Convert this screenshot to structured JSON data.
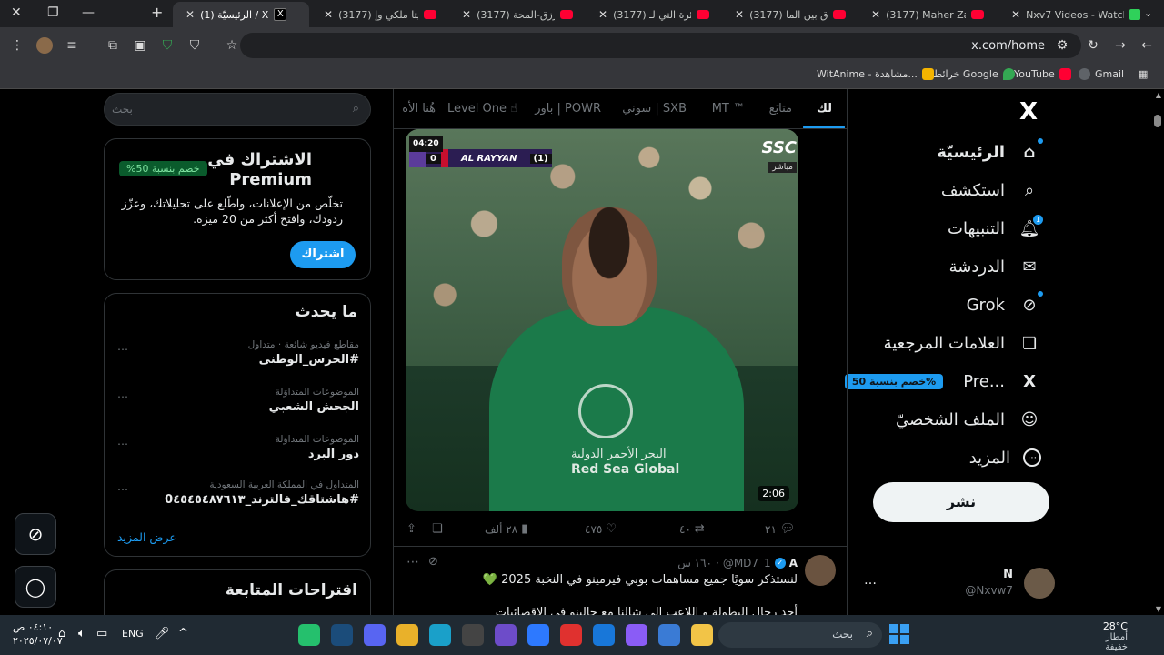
{
  "browser": {
    "tabs": [
      {
        "label": "Nxv7 Videos - Watch",
        "fav": "g"
      },
      {
        "label": "(3177) Maher Zain &",
        "fav": "yt"
      },
      {
        "label": "(3177) الفرق بين الما",
        "fav": "yt"
      },
      {
        "label": "(3177) الطائرة التي لـ",
        "fav": "yt"
      },
      {
        "label": "(3177) رشا رزق-المحة",
        "fav": "yt"
      },
      {
        "label": "(3177) ناديتا ملكي وإ",
        "fav": "yt"
      },
      {
        "label": "(1) الرئيسيّة / X",
        "fav": "x",
        "active": true
      }
    ],
    "new_tab": "+",
    "url": "x.com/home",
    "bookmarks": [
      {
        "label": "Gmail",
        "color": "#ea4335"
      },
      {
        "label": "YouTube",
        "color": "#ff0033"
      },
      {
        "label": "خرائط Google",
        "color": "#34a853"
      },
      {
        "label": "WitAnime - مشاهدة...",
        "color": "#f5b400"
      }
    ]
  },
  "nav": {
    "logo": "X",
    "items": [
      {
        "label": "الرئيسيّة",
        "icon": "home-icon",
        "glyph": "⌂"
      },
      {
        "label": "استكشف",
        "icon": "search-icon",
        "glyph": "⌕"
      },
      {
        "label": "التنبيهات",
        "icon": "bell-icon",
        "glyph": "♫",
        "badge": "1"
      },
      {
        "label": "الدردشة",
        "icon": "mail-icon",
        "glyph": "✉"
      },
      {
        "label": "Grok",
        "icon": "grok-icon",
        "glyph": "⊘"
      },
      {
        "label": "العلامات المرجعية",
        "icon": "bookmark-icon",
        "glyph": "❏"
      },
      {
        "label": "...Pre",
        "icon": "premium-x-icon",
        "glyph": "X",
        "pill": "%خصم بنسبة 50"
      },
      {
        "label": "الملف الشخصيّ",
        "icon": "profile-icon",
        "glyph": "☺"
      },
      {
        "label": "المزيد",
        "icon": "more-icon",
        "glyph": "⋯"
      }
    ],
    "post_button": "نشر",
    "account": {
      "name": "N",
      "handle": "@Nxvw7",
      "more": "…"
    }
  },
  "timeline": {
    "tabs": [
      "لك",
      "متابَع",
      "MT ™",
      "سوني | SXB",
      "باور | POWR",
      "Level One ☝",
      "هُنا الأه"
    ],
    "video": {
      "clock": "04:20",
      "score_left": "0",
      "team": "AL RAYYAN",
      "score_right": "(1)",
      "broadcaster": "SSC",
      "live": "مباشر",
      "shirt_line1": "البحر الأحمر الدولية",
      "shirt_line2": "Red Sea Global",
      "duration": "2:06"
    },
    "actions": {
      "replies": "٢١",
      "reposts": "٤٠",
      "likes": "٤٧٥",
      "views": "٢٨ ألف"
    },
    "tweet2": {
      "name": "A",
      "handle": "@MD7_1",
      "time": "١٦٠ س",
      "line1": "لنستذكر سويًا جميع مساهمات بوبي فيرمينو في النخبة 2025 💚",
      "line2": "أحد رجال البطولة و اللاعب الى شالنا مع جالينو في الاقصائيات"
    }
  },
  "sidebar": {
    "search_placeholder": "بحث",
    "premium": {
      "title": "الاشتراك في Premium",
      "badge": "%خصم بنسبة 50",
      "body": "تخلّص من الإعلانات، واطّلع على تحليلاتك، وعزّز ردودك، وافتح أكثر من 20 ميزة.",
      "button": "اشتراك"
    },
    "trends": {
      "title": "ما يحدث",
      "items": [
        {
          "meta": "مقاطع فيديو شائعة · متداول",
          "name": "#الحرس_الوطنى"
        },
        {
          "meta": "الموضوعات المتداوَلة",
          "name": "الجحش الشعبي"
        },
        {
          "meta": "الموضوعات المتداوَلة",
          "name": "دور البرد"
        },
        {
          "meta": "المتداول في المملكة العربية السعودية",
          "name": "#هاشتاقك_فالترند_0٤٥٤٥٤٨٧٦١٣"
        }
      ],
      "more_glyph": "⋯",
      "show_more": "عرض المزيد"
    },
    "follow": {
      "title": "اقتراحات المتابعة"
    }
  },
  "taskbar": {
    "search_placeholder": "بحث",
    "weather_temp": "28°C",
    "weather_desc": "أمطار خفيفة",
    "time": "٠٤:١٠ ص",
    "date": "٢٠٢٥/٠٧/٠٧",
    "lang": "ENG",
    "apps": [
      {
        "name": "file-explorer-icon",
        "color": "#f2c447"
      },
      {
        "name": "microsoft-store-icon",
        "color": "#3a7bd5"
      },
      {
        "name": "copilot-icon",
        "color": "#8a5cf6"
      },
      {
        "name": "outlook-icon",
        "color": "#1877d9"
      },
      {
        "name": "app-red-icon",
        "color": "#e0312f"
      },
      {
        "name": "dropbox-icon",
        "color": "#2d79ff"
      },
      {
        "name": "vs-icon",
        "color": "#6d4cc9"
      },
      {
        "name": "epic-games-icon",
        "color": "#444"
      },
      {
        "name": "edge-icon",
        "color": "#1aa0c9"
      },
      {
        "name": "chrome-icon",
        "color": "#e9b12a"
      },
      {
        "name": "discord-icon",
        "color": "#5865f2"
      },
      {
        "name": "steam-icon",
        "color": "#1b4c7a"
      },
      {
        "name": "app-green-icon",
        "color": "#25c06d"
      }
    ]
  }
}
